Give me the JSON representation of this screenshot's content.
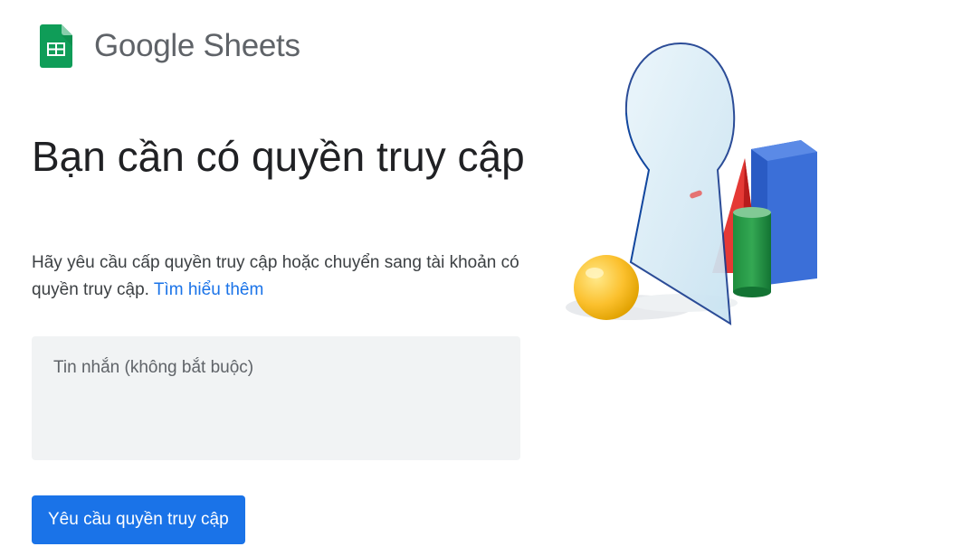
{
  "app": {
    "brand_name": "Google Sheets",
    "logo_icon": "google-sheets-icon",
    "brand_color": "#0f9d58"
  },
  "main": {
    "title": "Bạn cần có quyền truy cập",
    "description": "Hãy yêu cầu cấp quyền truy cập hoặc chuyển sang tài khoản có quyền truy cập.",
    "learn_more_link": "Tìm hiểu thêm",
    "message_placeholder": "Tin nhắn (không bắt buộc)",
    "message_value": "",
    "request_button_label": "Yêu cầu quyền truy cập"
  },
  "illustration": {
    "icon": "keyhole-with-shapes-illustration"
  },
  "colors": {
    "accent": "#1a73e8",
    "input_background": "#f1f3f4",
    "muted_text": "#5f6368"
  }
}
